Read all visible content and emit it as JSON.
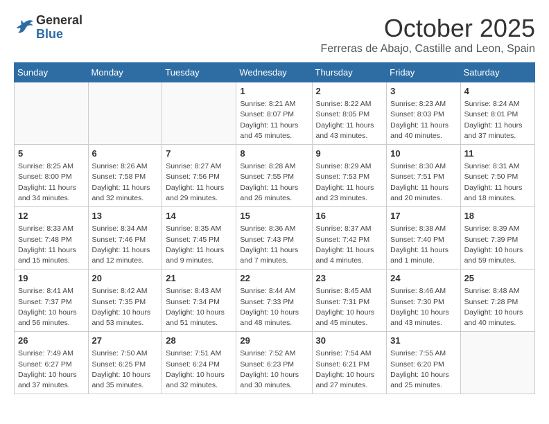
{
  "header": {
    "logo_general": "General",
    "logo_blue": "Blue",
    "month_year": "October 2025",
    "location": "Ferreras de Abajo, Castille and Leon, Spain"
  },
  "days_of_week": [
    "Sunday",
    "Monday",
    "Tuesday",
    "Wednesday",
    "Thursday",
    "Friday",
    "Saturday"
  ],
  "weeks": [
    [
      {
        "day": "",
        "info": ""
      },
      {
        "day": "",
        "info": ""
      },
      {
        "day": "",
        "info": ""
      },
      {
        "day": "1",
        "info": "Sunrise: 8:21 AM\nSunset: 8:07 PM\nDaylight: 11 hours\nand 45 minutes."
      },
      {
        "day": "2",
        "info": "Sunrise: 8:22 AM\nSunset: 8:05 PM\nDaylight: 11 hours\nand 43 minutes."
      },
      {
        "day": "3",
        "info": "Sunrise: 8:23 AM\nSunset: 8:03 PM\nDaylight: 11 hours\nand 40 minutes."
      },
      {
        "day": "4",
        "info": "Sunrise: 8:24 AM\nSunset: 8:01 PM\nDaylight: 11 hours\nand 37 minutes."
      }
    ],
    [
      {
        "day": "5",
        "info": "Sunrise: 8:25 AM\nSunset: 8:00 PM\nDaylight: 11 hours\nand 34 minutes."
      },
      {
        "day": "6",
        "info": "Sunrise: 8:26 AM\nSunset: 7:58 PM\nDaylight: 11 hours\nand 32 minutes."
      },
      {
        "day": "7",
        "info": "Sunrise: 8:27 AM\nSunset: 7:56 PM\nDaylight: 11 hours\nand 29 minutes."
      },
      {
        "day": "8",
        "info": "Sunrise: 8:28 AM\nSunset: 7:55 PM\nDaylight: 11 hours\nand 26 minutes."
      },
      {
        "day": "9",
        "info": "Sunrise: 8:29 AM\nSunset: 7:53 PM\nDaylight: 11 hours\nand 23 minutes."
      },
      {
        "day": "10",
        "info": "Sunrise: 8:30 AM\nSunset: 7:51 PM\nDaylight: 11 hours\nand 20 minutes."
      },
      {
        "day": "11",
        "info": "Sunrise: 8:31 AM\nSunset: 7:50 PM\nDaylight: 11 hours\nand 18 minutes."
      }
    ],
    [
      {
        "day": "12",
        "info": "Sunrise: 8:33 AM\nSunset: 7:48 PM\nDaylight: 11 hours\nand 15 minutes."
      },
      {
        "day": "13",
        "info": "Sunrise: 8:34 AM\nSunset: 7:46 PM\nDaylight: 11 hours\nand 12 minutes."
      },
      {
        "day": "14",
        "info": "Sunrise: 8:35 AM\nSunset: 7:45 PM\nDaylight: 11 hours\nand 9 minutes."
      },
      {
        "day": "15",
        "info": "Sunrise: 8:36 AM\nSunset: 7:43 PM\nDaylight: 11 hours\nand 7 minutes."
      },
      {
        "day": "16",
        "info": "Sunrise: 8:37 AM\nSunset: 7:42 PM\nDaylight: 11 hours\nand 4 minutes."
      },
      {
        "day": "17",
        "info": "Sunrise: 8:38 AM\nSunset: 7:40 PM\nDaylight: 11 hours\nand 1 minute."
      },
      {
        "day": "18",
        "info": "Sunrise: 8:39 AM\nSunset: 7:39 PM\nDaylight: 10 hours\nand 59 minutes."
      }
    ],
    [
      {
        "day": "19",
        "info": "Sunrise: 8:41 AM\nSunset: 7:37 PM\nDaylight: 10 hours\nand 56 minutes."
      },
      {
        "day": "20",
        "info": "Sunrise: 8:42 AM\nSunset: 7:35 PM\nDaylight: 10 hours\nand 53 minutes."
      },
      {
        "day": "21",
        "info": "Sunrise: 8:43 AM\nSunset: 7:34 PM\nDaylight: 10 hours\nand 51 minutes."
      },
      {
        "day": "22",
        "info": "Sunrise: 8:44 AM\nSunset: 7:33 PM\nDaylight: 10 hours\nand 48 minutes."
      },
      {
        "day": "23",
        "info": "Sunrise: 8:45 AM\nSunset: 7:31 PM\nDaylight: 10 hours\nand 45 minutes."
      },
      {
        "day": "24",
        "info": "Sunrise: 8:46 AM\nSunset: 7:30 PM\nDaylight: 10 hours\nand 43 minutes."
      },
      {
        "day": "25",
        "info": "Sunrise: 8:48 AM\nSunset: 7:28 PM\nDaylight: 10 hours\nand 40 minutes."
      }
    ],
    [
      {
        "day": "26",
        "info": "Sunrise: 7:49 AM\nSunset: 6:27 PM\nDaylight: 10 hours\nand 37 minutes."
      },
      {
        "day": "27",
        "info": "Sunrise: 7:50 AM\nSunset: 6:25 PM\nDaylight: 10 hours\nand 35 minutes."
      },
      {
        "day": "28",
        "info": "Sunrise: 7:51 AM\nSunset: 6:24 PM\nDaylight: 10 hours\nand 32 minutes."
      },
      {
        "day": "29",
        "info": "Sunrise: 7:52 AM\nSunset: 6:23 PM\nDaylight: 10 hours\nand 30 minutes."
      },
      {
        "day": "30",
        "info": "Sunrise: 7:54 AM\nSunset: 6:21 PM\nDaylight: 10 hours\nand 27 minutes."
      },
      {
        "day": "31",
        "info": "Sunrise: 7:55 AM\nSunset: 6:20 PM\nDaylight: 10 hours\nand 25 minutes."
      },
      {
        "day": "",
        "info": ""
      }
    ]
  ]
}
